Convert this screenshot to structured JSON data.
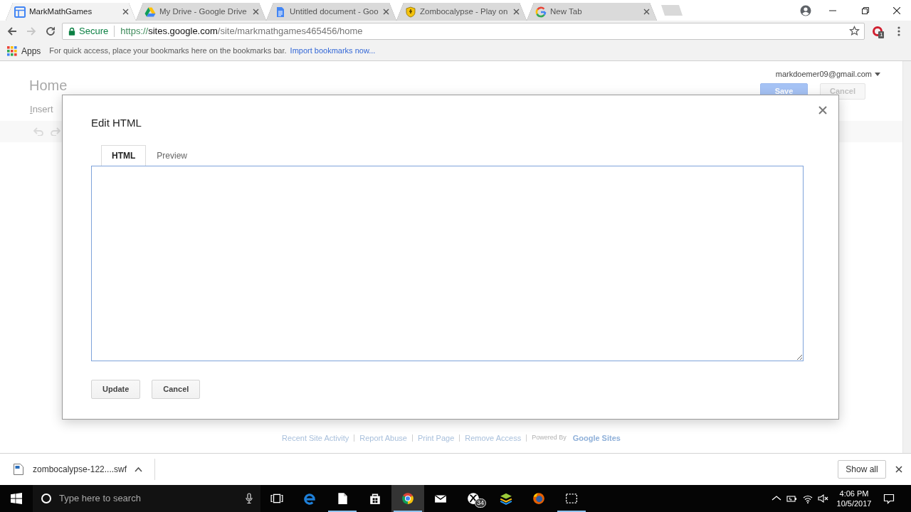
{
  "browser": {
    "tabs": [
      {
        "title": "MarkMathGames",
        "kind": "sites",
        "selected": true
      },
      {
        "title": "My Drive - Google Drive",
        "kind": "drive",
        "selected": false
      },
      {
        "title": "Untitled document - Goo",
        "kind": "docs",
        "selected": false
      },
      {
        "title": "Zombocalypse - Play on",
        "kind": "shield",
        "selected": false
      },
      {
        "title": "New Tab",
        "kind": "google",
        "selected": false
      }
    ],
    "nav": [
      {
        "kind": "back",
        "disabled": false
      },
      {
        "kind": "forward",
        "disabled": true
      },
      {
        "kind": "reload",
        "disabled": false
      }
    ],
    "omnibox": {
      "security": "Secure",
      "scheme": "https://",
      "host": "sites.google.com",
      "path": "/site/markmathgames465456/home"
    },
    "extension_badge": "1",
    "bookmarks_bar": {
      "apps": "Apps",
      "hint": "For quick access, place your bookmarks here on the bookmarks bar.",
      "import_link": "Import bookmarks now..."
    }
  },
  "site": {
    "page_title": "Home",
    "menu": [
      "Insert"
    ],
    "account": "markdoemer09@gmail.com",
    "buttons": [
      {
        "label": "Save",
        "kind": "primary"
      },
      {
        "label": "Cancel",
        "kind": "secondary"
      }
    ],
    "footer": {
      "links": [
        "Recent Site Activity",
        "Report Abuse",
        "Print Page",
        "Remove Access"
      ],
      "powered_by": "Powered By",
      "brand": "Google Sites"
    }
  },
  "dialog": {
    "title": "Edit HTML",
    "tabs": [
      {
        "label": "HTML",
        "selected": true
      },
      {
        "label": "Preview",
        "selected": false
      }
    ],
    "buttons": [
      "Update",
      "Cancel"
    ]
  },
  "download_shelf": {
    "file": "zombocalypse-122....swf",
    "show_all": "Show all"
  },
  "taskbar": {
    "search_placeholder": "Type here to search",
    "apps": [
      {
        "kind": "task-view",
        "running": false,
        "active": false
      },
      {
        "kind": "edge",
        "running": false,
        "active": false
      },
      {
        "kind": "file",
        "running": true,
        "active": false
      },
      {
        "kind": "store",
        "running": false,
        "active": false
      },
      {
        "kind": "chrome",
        "running": true,
        "active": true
      },
      {
        "kind": "mail",
        "running": false,
        "active": false
      },
      {
        "kind": "xbox",
        "running": false,
        "active": false,
        "badge": "34"
      },
      {
        "kind": "bluestacks",
        "running": false,
        "active": false
      },
      {
        "kind": "firefox",
        "running": false,
        "active": false
      },
      {
        "kind": "snip",
        "running": true,
        "active": false
      }
    ],
    "clock": {
      "time": "4:06 PM",
      "date": "10/5/2017"
    }
  }
}
